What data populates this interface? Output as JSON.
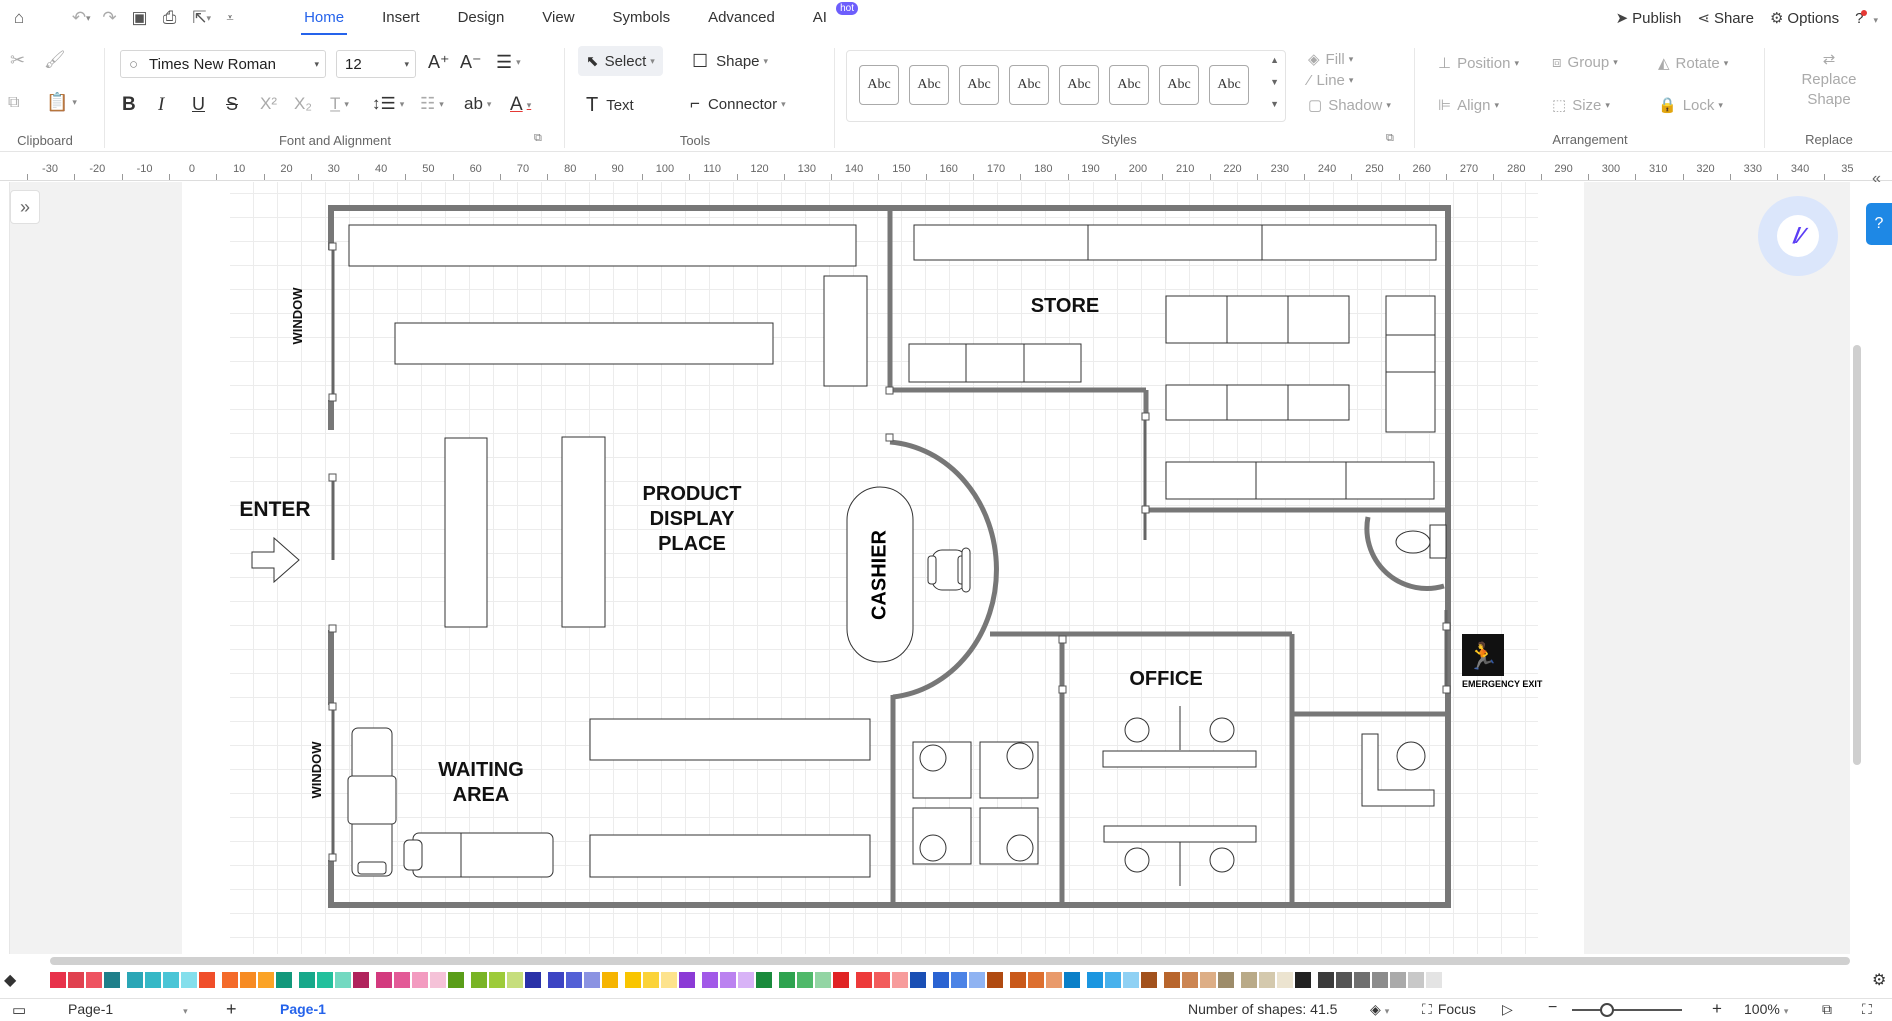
{
  "topbar": {
    "menus": [
      "Home",
      "Insert",
      "Design",
      "View",
      "Symbols",
      "Advanced",
      "AI"
    ],
    "active": "Home",
    "hot_badge": "hot",
    "publish": "Publish",
    "share": "Share",
    "options": "Options"
  },
  "font": {
    "family": "Times New Roman",
    "size": "12"
  },
  "tools": {
    "select": "Select",
    "shape": "Shape",
    "text": "Text",
    "connector": "Connector"
  },
  "styles": {
    "sample": [
      "Abc",
      "Abc",
      "Abc",
      "Abc",
      "Abc",
      "Abc",
      "Abc",
      "Abc"
    ],
    "fill": "Fill",
    "line": "Line",
    "shadow": "Shadow"
  },
  "arrangement": {
    "position": "Position",
    "group": "Group",
    "rotate": "Rotate",
    "align": "Align",
    "size": "Size",
    "lock": "Lock"
  },
  "replace": {
    "label": "Replace Shape"
  },
  "groups": {
    "clipboard": "Clipboard",
    "font": "Font and Alignment",
    "tools": "Tools",
    "styles": "Styles",
    "arrangement": "Arrangement",
    "replace": "Replace"
  },
  "ruler": {
    "ticks": [
      "-30",
      "-20",
      "-10",
      "0",
      "10",
      "20",
      "30",
      "40",
      "50",
      "60",
      "70",
      "80",
      "90",
      "100",
      "110",
      "120",
      "130",
      "140",
      "150",
      "160",
      "170",
      "180",
      "190",
      "200",
      "210",
      "220",
      "230",
      "240",
      "250",
      "260",
      "270",
      "280",
      "290",
      "300",
      "310",
      "320",
      "330",
      "340",
      "35"
    ]
  },
  "plan": {
    "labels": {
      "store": "STORE",
      "product": [
        "PRODUCT",
        "DISPLAY",
        "PLACE"
      ],
      "enter": "ENTER",
      "cashier": "CASHIER",
      "office": "OFFICE",
      "waiting": [
        "WAITING",
        "AREA"
      ],
      "window_top": "WINDOW",
      "window_bottom": "WINDOW",
      "exit": "EMERGENCY EXIT"
    }
  },
  "palette": {
    "colors": [
      "#e8314a",
      "#e0414f",
      "#ee5361",
      "#1f7f8a",
      "#2aa6b6",
      "#35b8c6",
      "#4ac5d6",
      "#84dfec",
      "#f04e2a",
      "#f46b2a",
      "#f78b23",
      "#fba326",
      "#12987b",
      "#17a88a",
      "#22c09c",
      "#73d9c1",
      "#b0235c",
      "#d33a7e",
      "#e35a97",
      "#f39bc0",
      "#f5c2d8",
      "#5a9d19",
      "#79b425",
      "#9dcb3a",
      "#c6de7c",
      "#2931a8",
      "#3c44c3",
      "#5360d6",
      "#8b93e2",
      "#f6b400",
      "#f9c500",
      "#fbd33a",
      "#fde38d",
      "#8b3ad6",
      "#a259e8",
      "#bb82f0",
      "#d8b3f7",
      "#1a8a3c",
      "#2ea34f",
      "#4fb96a",
      "#93d5a4",
      "#e02424",
      "#ed3a3a",
      "#f25c5c",
      "#f79c9c",
      "#1a4fb4",
      "#2a63d2",
      "#4b83e6",
      "#8fb3f2",
      "#b04a10",
      "#c9591a",
      "#dd6f2f",
      "#e99a6b",
      "#0a7fc8",
      "#1b96e0",
      "#47b1ec",
      "#8fd1f4",
      "#a2511c",
      "#b8652c",
      "#cc8552",
      "#ddae86",
      "#9d8c6a",
      "#b9aa88",
      "#d4c9ad",
      "#ece4d0",
      "#222222",
      "#3b3b3b",
      "#555555",
      "#6f6f6f",
      "#8c8c8c",
      "#aaaaaa",
      "#c8c8c8",
      "#e4e4e4"
    ]
  },
  "status": {
    "page_selector": "Page-1",
    "page_tab": "Page-1",
    "shapes": "Number of shapes: 41.5",
    "focus": "Focus",
    "zoom": "100%"
  }
}
